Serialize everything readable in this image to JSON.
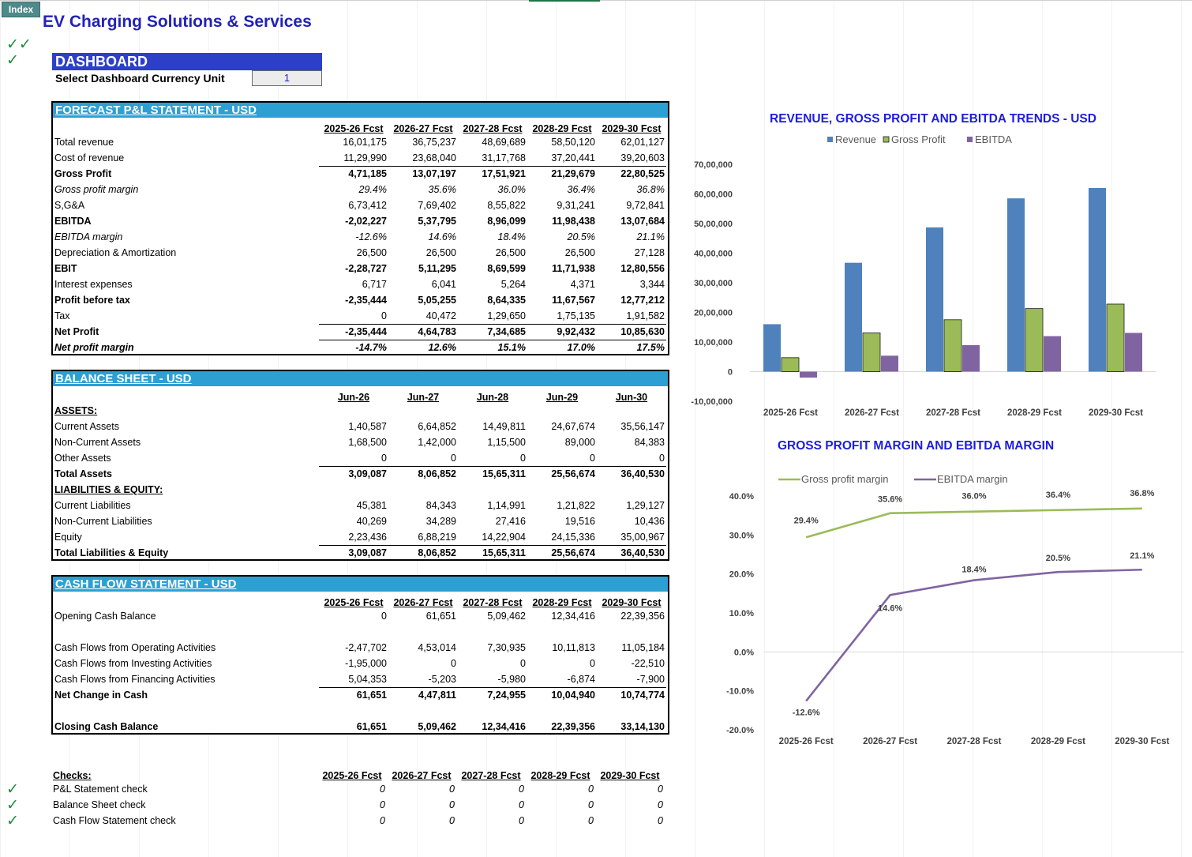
{
  "index_button": "Index",
  "title": "EV Charging Solutions & Services",
  "dashboard": {
    "header": "DASHBOARD",
    "currency_label": "Select Dashboard Currency Unit",
    "currency_value": "1"
  },
  "years": [
    "2025-26 Fcst",
    "2026-27 Fcst",
    "2027-28 Fcst",
    "2028-29 Fcst",
    "2029-30 Fcst"
  ],
  "pl": {
    "header": "FORECAST P&L STATEMENT - USD",
    "rows": [
      {
        "label": "Total revenue",
        "values": [
          "16,01,175",
          "36,75,237",
          "48,69,689",
          "58,50,120",
          "62,01,127"
        ],
        "style": ""
      },
      {
        "label": "Cost of revenue",
        "values": [
          "11,29,990",
          "23,68,040",
          "31,17,768",
          "37,20,441",
          "39,20,603"
        ],
        "style": ""
      },
      {
        "label": "Gross Profit",
        "values": [
          "4,71,185",
          "13,07,197",
          "17,51,921",
          "21,29,679",
          "22,80,525"
        ],
        "style": "bold topline-row"
      },
      {
        "label": "Gross profit margin",
        "values": [
          "29.4%",
          "35.6%",
          "36.0%",
          "36.4%",
          "36.8%"
        ],
        "style": "ital"
      },
      {
        "label": "S,G&A",
        "values": [
          "6,73,412",
          "7,69,402",
          "8,55,822",
          "9,31,241",
          "9,72,841"
        ],
        "style": ""
      },
      {
        "label": "EBITDA",
        "values": [
          "-2,02,227",
          "5,37,795",
          "8,96,099",
          "11,98,438",
          "13,07,684"
        ],
        "style": "bold"
      },
      {
        "label": "EBITDA margin",
        "values": [
          "-12.6%",
          "14.6%",
          "18.4%",
          "20.5%",
          "21.1%"
        ],
        "style": "ital"
      },
      {
        "label": "Depreciation & Amortization",
        "values": [
          "26,500",
          "26,500",
          "26,500",
          "26,500",
          "27,128"
        ],
        "style": ""
      },
      {
        "label": "EBIT",
        "values": [
          "-2,28,727",
          "5,11,295",
          "8,69,599",
          "11,71,938",
          "12,80,556"
        ],
        "style": "bold"
      },
      {
        "label": "Interest expenses",
        "values": [
          "6,717",
          "6,041",
          "5,264",
          "4,371",
          "3,344"
        ],
        "style": ""
      },
      {
        "label": "Profit before tax",
        "values": [
          "-2,35,444",
          "5,05,255",
          "8,64,335",
          "11,67,567",
          "12,77,212"
        ],
        "style": "bold"
      },
      {
        "label": "Tax",
        "values": [
          "0",
          "40,472",
          "1,29,650",
          "1,75,135",
          "1,91,582"
        ],
        "style": ""
      },
      {
        "label": "Net Profit",
        "values": [
          "-2,35,444",
          "4,64,783",
          "7,34,685",
          "9,92,432",
          "10,85,630"
        ],
        "style": "bold topline-row"
      },
      {
        "label": "Net profit margin",
        "values": [
          "-14.7%",
          "12.6%",
          "15.1%",
          "17.0%",
          "17.5%"
        ],
        "style": "bold ital topline-row"
      }
    ]
  },
  "bs": {
    "header": "BALANCE SHEET - USD",
    "periods": [
      "Jun-26",
      "Jun-27",
      "Jun-28",
      "Jun-29",
      "Jun-30"
    ],
    "rows": [
      {
        "label": "ASSETS:",
        "values": [
          "",
          "",
          "",
          "",
          ""
        ],
        "style": "under"
      },
      {
        "label": "Current Assets",
        "values": [
          "1,40,587",
          "6,64,852",
          "14,49,811",
          "24,67,674",
          "35,56,147"
        ],
        "style": ""
      },
      {
        "label": "Non-Current Assets",
        "values": [
          "1,68,500",
          "1,42,000",
          "1,15,500",
          "89,000",
          "84,383"
        ],
        "style": ""
      },
      {
        "label": "Other Assets",
        "values": [
          "0",
          "0",
          "0",
          "0",
          "0"
        ],
        "style": ""
      },
      {
        "label": "Total Assets",
        "values": [
          "3,09,087",
          "8,06,852",
          "15,65,311",
          "25,56,674",
          "36,40,530"
        ],
        "style": "bold topline-row"
      },
      {
        "label": "LIABILITIES & EQUITY:",
        "values": [
          "",
          "",
          "",
          "",
          ""
        ],
        "style": "under"
      },
      {
        "label": "Current Liabilities",
        "values": [
          "45,381",
          "84,343",
          "1,14,991",
          "1,21,822",
          "1,29,127"
        ],
        "style": ""
      },
      {
        "label": "Non-Current Liabilities",
        "values": [
          "40,269",
          "34,289",
          "27,416",
          "19,516",
          "10,436"
        ],
        "style": ""
      },
      {
        "label": "Equity",
        "values": [
          "2,23,436",
          "6,88,219",
          "14,22,904",
          "24,15,336",
          "35,00,967"
        ],
        "style": ""
      },
      {
        "label": "Total Liabilities & Equity",
        "values": [
          "3,09,087",
          "8,06,852",
          "15,65,311",
          "25,56,674",
          "36,40,530"
        ],
        "style": "bold topline-row"
      }
    ]
  },
  "cf": {
    "header": "CASH FLOW STATEMENT -  USD",
    "rows": [
      {
        "label": "Opening Cash Balance",
        "values": [
          "0",
          "61,651",
          "5,09,462",
          "12,34,416",
          "22,39,356"
        ],
        "style": ""
      },
      {
        "label": "",
        "values": [
          "",
          "",
          "",
          "",
          ""
        ],
        "style": "spacer"
      },
      {
        "label": "Cash Flows from Operating Activities",
        "values": [
          "-2,47,702",
          "4,53,014",
          "7,30,935",
          "10,11,813",
          "11,05,184"
        ],
        "style": ""
      },
      {
        "label": "Cash Flows from Investing Activities",
        "values": [
          "-1,95,000",
          "0",
          "0",
          "0",
          "-22,510"
        ],
        "style": ""
      },
      {
        "label": "Cash Flows from Financing Activities",
        "values": [
          "5,04,353",
          "-5,203",
          "-5,980",
          "-6,874",
          "-7,900"
        ],
        "style": ""
      },
      {
        "label": "Net Change in Cash",
        "values": [
          "61,651",
          "4,47,811",
          "7,24,955",
          "10,04,940",
          "10,74,774"
        ],
        "style": "bold topline-row"
      },
      {
        "label": "",
        "values": [
          "",
          "",
          "",
          "",
          ""
        ],
        "style": "spacer"
      },
      {
        "label": "Closing Cash Balance",
        "values": [
          "61,651",
          "5,09,462",
          "12,34,416",
          "22,39,356",
          "33,14,130"
        ],
        "style": "bold"
      }
    ]
  },
  "checks": {
    "header": "Checks:",
    "rows": [
      {
        "label": "P&L Statement check",
        "values": [
          "0",
          "0",
          "0",
          "0",
          "0"
        ],
        "style": "ital-num"
      },
      {
        "label": "Balance Sheet check",
        "values": [
          "0",
          "0",
          "0",
          "0",
          "0"
        ],
        "style": "ital-num"
      },
      {
        "label": "Cash Flow Statement check",
        "values": [
          "0",
          "0",
          "0",
          "0",
          "0"
        ],
        "style": "ital-num"
      }
    ]
  },
  "chart_data": [
    {
      "type": "bar",
      "title": "REVENUE, GROSS PROFIT AND EBITDA TRENDS - USD",
      "categories": [
        "2025-26 Fcst",
        "2026-27 Fcst",
        "2027-28 Fcst",
        "2028-29 Fcst",
        "2029-30 Fcst"
      ],
      "series": [
        {
          "name": "Revenue",
          "color": "#4f81bd",
          "values": [
            1601175,
            3675237,
            4869689,
            5850120,
            6201127
          ]
        },
        {
          "name": "Gross Profit",
          "color": "#9bbb59",
          "values": [
            471185,
            1307197,
            1751921,
            2129679,
            2280525
          ]
        },
        {
          "name": "EBITDA",
          "color": "#8064a2",
          "values": [
            -202227,
            537795,
            896099,
            1198438,
            1307684
          ]
        }
      ],
      "ylim": [
        -1000000,
        7000000
      ],
      "yticks": [
        -1000000,
        0,
        1000000,
        2000000,
        3000000,
        4000000,
        5000000,
        6000000,
        7000000
      ],
      "ytick_labels": [
        "-10,00,000",
        "0",
        "10,00,000",
        "20,00,000",
        "30,00,000",
        "40,00,000",
        "50,00,000",
        "60,00,000",
        "70,00,000"
      ],
      "legend": "top"
    },
    {
      "type": "line",
      "title": "GROSS PROFIT MARGIN AND EBITDA MARGIN",
      "categories": [
        "2025-26 Fcst",
        "2026-27 Fcst",
        "2027-28 Fcst",
        "2028-29 Fcst",
        "2029-30 Fcst"
      ],
      "series": [
        {
          "name": "Gross profit margin",
          "color": "#9bbb59",
          "values": [
            29.4,
            35.6,
            36.0,
            36.4,
            36.8
          ],
          "labels": [
            "29.4%",
            "35.6%",
            "36.0%",
            "36.4%",
            "36.8%"
          ]
        },
        {
          "name": "EBITDA margin",
          "color": "#8064a2",
          "values": [
            -12.6,
            14.6,
            18.4,
            20.5,
            21.1
          ],
          "labels": [
            "-12.6%",
            "14.6%",
            "18.4%",
            "20.5%",
            "21.1%"
          ]
        }
      ],
      "ylim": [
        -20,
        40
      ],
      "yticks": [
        -20,
        -10,
        0,
        10,
        20,
        30,
        40
      ],
      "ytick_labels": [
        "-20.0%",
        "-10.0%",
        "0.0%",
        "10.0%",
        "20.0%",
        "30.0%",
        "40.0%"
      ],
      "legend": "top"
    }
  ]
}
